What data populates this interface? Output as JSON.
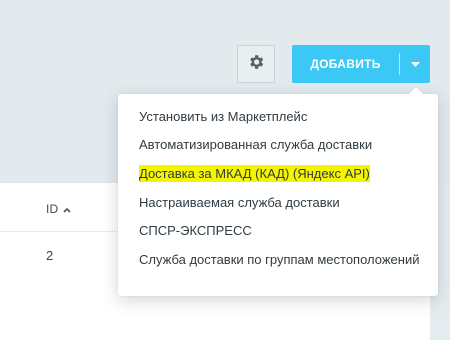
{
  "toolbar": {
    "add_label": "ДОБАВИТЬ"
  },
  "icons": {
    "settings": "gear-icon",
    "dropdown": "chevron-down-icon",
    "sort": "sort-up-icon"
  },
  "colors": {
    "accent": "#3bc8f5",
    "highlight": "#f5f500"
  },
  "dropdown": {
    "items": [
      {
        "label": "Установить из Маркетплейс",
        "highlighted": false
      },
      {
        "label": "Автоматизированная служба доставки",
        "highlighted": false
      },
      {
        "label": "Доставка за МКАД (КАД) (Яндекс API)",
        "highlighted": true
      },
      {
        "label": "Настраиваемая служба доставки",
        "highlighted": false
      },
      {
        "label": "СПСР-ЭКСПРЕСС",
        "highlighted": false
      },
      {
        "label": "Служба доставки по группам местоположений",
        "highlighted": false
      }
    ]
  },
  "table": {
    "columns": [
      "ID"
    ],
    "rows": [
      [
        "2"
      ]
    ]
  }
}
